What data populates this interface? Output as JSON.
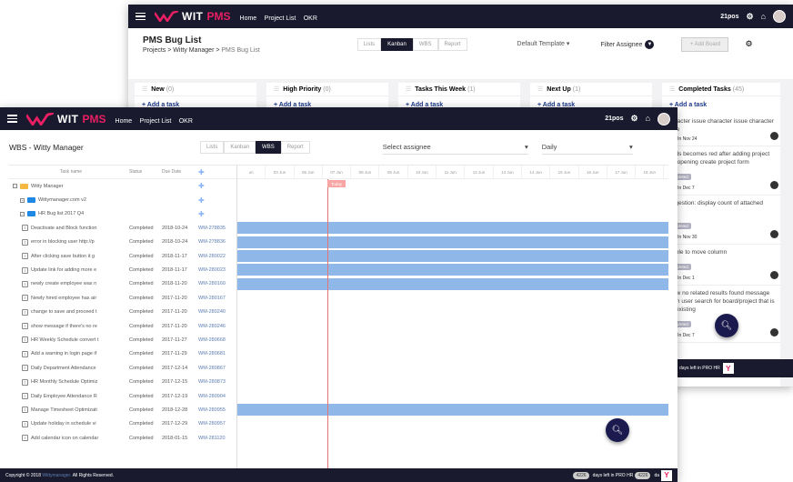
{
  "nav": {
    "brand": "WIT",
    "product": "PMS",
    "items": [
      "Home",
      "Project List",
      "OKR"
    ],
    "user": "21pos"
  },
  "back": {
    "title": "PMS Bug List",
    "crumb": [
      "Projects",
      "Witty Manager",
      "PMS Bug List"
    ],
    "tabs": [
      "Lists",
      "Kanban",
      "WBS",
      "Report"
    ],
    "template": "Default Template",
    "filter": "Filter Assignee",
    "add_board": "+ Add Board",
    "columns": [
      {
        "name": "New",
        "count": "(0)"
      },
      {
        "name": "High Priority",
        "count": "(0)"
      },
      {
        "name": "Tasks This Week",
        "count": "(1)"
      },
      {
        "name": "Next Up",
        "count": "(1)"
      },
      {
        "name": "Completed Tasks",
        "count": "(45)"
      }
    ],
    "add_task": "+ Add a task",
    "cards": [
      {
        "text": "character issue character issue character issue",
        "due": "Due On Nov 24"
      },
      {
        "text": "Fields becomes red after adding project and opening create project form",
        "due": "Due On Dec 7"
      },
      {
        "text": "suggestion: display count of attached files",
        "due": "Due On Nov 30"
      },
      {
        "text": "unable to move column",
        "due": "Due On Dec 1"
      },
      {
        "text": "Show no related results found message when user search for board/project that is not existing",
        "due": "Due On Dec 7"
      }
    ],
    "badge": "Completed",
    "footer": "days left in PRO HR"
  },
  "front": {
    "title": "WBS - Witty Manager",
    "tabs": [
      "Lists",
      "Kanban",
      "WBS",
      "Report"
    ],
    "assignee_placeholder": "Select assignee",
    "period": "Daily",
    "headers": {
      "name": "Task name",
      "status": "Status",
      "due": "Due Date"
    },
    "days": [
      "un",
      "03 Jun",
      "06 Jun",
      "07 Jun",
      "08 Jun",
      "09 Jun",
      "10 Jun",
      "11 Jun",
      "12 Jun",
      "13 Jun",
      "14 Jun",
      "15 Jun",
      "16 Jun",
      "17 Jun",
      "18 Jun",
      "1"
    ],
    "today": "Today",
    "groups": [
      "Witty Manager",
      "Wittymanager.com v2",
      "HR Bug list 2017 Q4"
    ],
    "rows": [
      {
        "name": "Deactivate and Block function",
        "status": "Completed",
        "due": "2018-10-24",
        "id": "WM-278835",
        "bar": true
      },
      {
        "name": "error in blocking user http://p",
        "status": "Completed",
        "due": "2018-10-24",
        "id": "WM-278836",
        "bar": true
      },
      {
        "name": "After clicking save button it g",
        "status": "Completed",
        "due": "2018-11-17",
        "id": "WM-280022",
        "bar": true
      },
      {
        "name": "Update link for adding more e",
        "status": "Completed",
        "due": "2018-11-17",
        "id": "WM-280023",
        "bar": true
      },
      {
        "name": "newly create employee was n",
        "status": "Completed",
        "due": "2018-11-20",
        "id": "WM-280160",
        "bar": true
      },
      {
        "name": "Newly hired employee has air",
        "status": "Completed",
        "due": "2017-11-20",
        "id": "WM-280167",
        "bar": false
      },
      {
        "name": "change to save and proceed t",
        "status": "Completed",
        "due": "2017-11-20",
        "id": "WM-280240",
        "bar": false
      },
      {
        "name": "show message if there's no re",
        "status": "Completed",
        "due": "2017-11-20",
        "id": "WM-280246",
        "bar": false
      },
      {
        "name": "HR Weekly Schedule convert t",
        "status": "Completed",
        "due": "2017-11-27",
        "id": "WM-280668",
        "bar": false
      },
      {
        "name": "Add a warning in login page if",
        "status": "Completed",
        "due": "2017-11-29",
        "id": "WM-280681",
        "bar": false
      },
      {
        "name": "Daily Department Attendance",
        "status": "Completed",
        "due": "2017-12-14",
        "id": "WM-280867",
        "bar": false
      },
      {
        "name": "HR Monthly Schedule Optimiz",
        "status": "Completed",
        "due": "2017-12-15",
        "id": "WM-280873",
        "bar": false
      },
      {
        "name": "Daily Employee Attendance R",
        "status": "Completed",
        "due": "2017-12-19",
        "id": "WM-280904",
        "bar": false
      },
      {
        "name": "Manage Timesheet Optimizati",
        "status": "Completed",
        "due": "2018-12-28",
        "id": "WM-280955",
        "bar": true
      },
      {
        "name": "Update holiday in schedule vi",
        "status": "Completed",
        "due": "2017-12-29",
        "id": "WM-280957",
        "bar": false
      },
      {
        "name": "Add calendar icon on calendar",
        "status": "Completed",
        "due": "2018-01-15",
        "id": "WM-281120",
        "bar": false
      }
    ],
    "footer": {
      "copy_pre": "Copyright © 2018",
      "copy_link": "Wittymanager.",
      "copy_post": "All Rights Reserved.",
      "days": "4226",
      "days_text": "days left in PRO HR",
      "pill2": "4226",
      "tail": "da"
    }
  }
}
